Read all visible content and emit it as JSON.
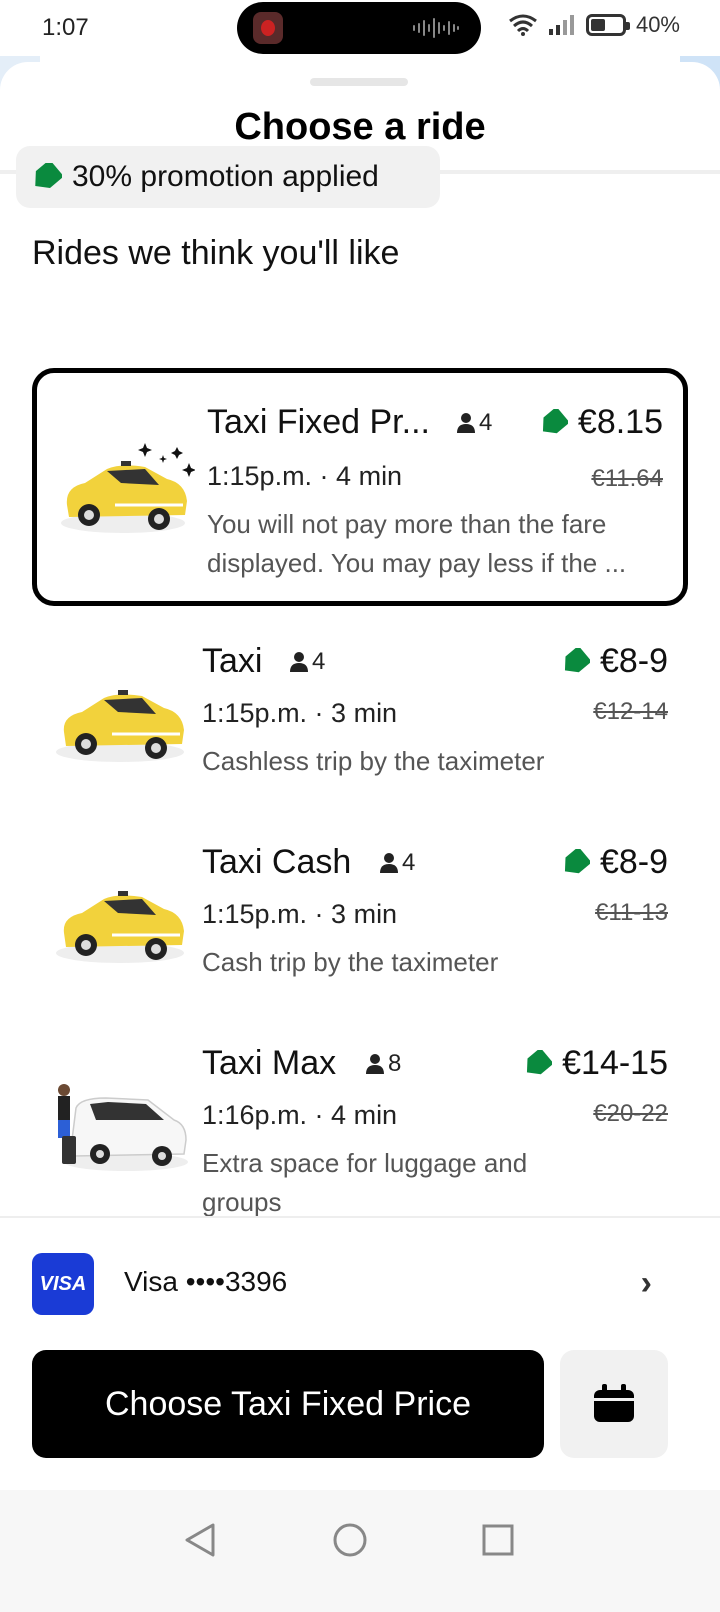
{
  "status_bar": {
    "time": "1:07",
    "battery": "40%"
  },
  "sheet": {
    "title": "Choose a ride"
  },
  "promo": {
    "text": "30% promotion applied",
    "tag_color": "#0a8a3e"
  },
  "section": {
    "title": "Rides we think you'll like"
  },
  "rides": [
    {
      "name": "Taxi Fixed Pr...",
      "capacity": "4",
      "price": "€8.15",
      "eta": "1:15p.m. · 4 min",
      "old_price": "€11.64",
      "description": "You will not pay more than the fare displayed. You may pay less if the ..."
    },
    {
      "name": "Taxi",
      "capacity": "4",
      "price": "€8-9",
      "eta": "1:15p.m. · 3 min",
      "old_price": "€12-14",
      "description": "Cashless trip by the taximeter"
    },
    {
      "name": "Taxi Cash",
      "capacity": "4",
      "price": "€8-9",
      "eta": "1:15p.m. · 3 min",
      "old_price": "€11-13",
      "description": "Cash trip by the taximeter"
    },
    {
      "name": "Taxi Max",
      "capacity": "8",
      "price": "€14-15",
      "eta": "1:16p.m. · 4 min",
      "old_price": "€20-22",
      "description": "Extra space for luggage and groups"
    }
  ],
  "payment": {
    "brand": "VISA",
    "label": "Visa ••••3396",
    "chevron": "›"
  },
  "cta": {
    "label": "Choose Taxi Fixed Price"
  },
  "colors": {
    "accent_green": "#0a8a3e",
    "visa_blue": "#1a3bd6",
    "taxi_yellow": "#f2d23c"
  }
}
